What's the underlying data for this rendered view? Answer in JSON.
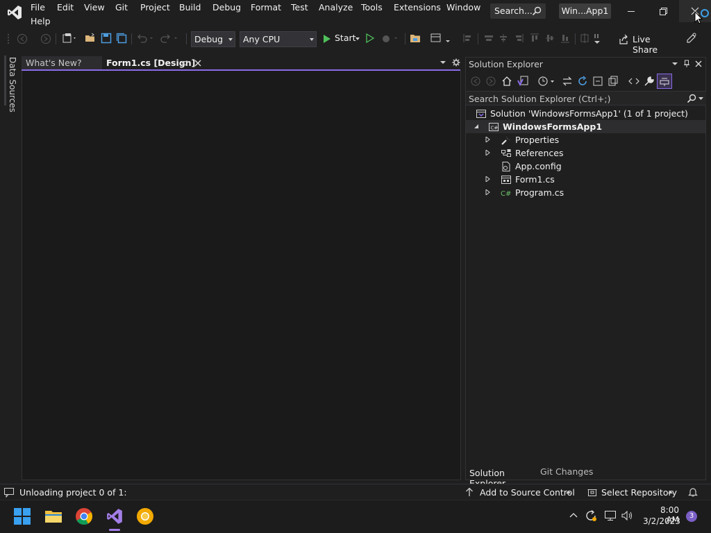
{
  "titlebar": {
    "menu": [
      "File",
      "Edit",
      "View",
      "Git",
      "Project",
      "Build",
      "Debug",
      "Format",
      "Test",
      "Analyze",
      "Tools",
      "Extensions",
      "Window",
      "Help"
    ],
    "search_label": "Search...",
    "solution_badge": "Win...App1"
  },
  "toolbar": {
    "configuration": "Debug",
    "platform": "Any CPU",
    "start_label": "Start",
    "live_share_label": "Live Share"
  },
  "left_panel": {
    "data_sources_label": "Data Sources"
  },
  "document_tabs": [
    {
      "label": "What's New?",
      "active": false
    },
    {
      "label": "Form1.cs [Design]",
      "active": true
    }
  ],
  "solution_explorer": {
    "title": "Solution Explorer",
    "search_placeholder": "Search Solution Explorer (Ctrl+;)",
    "tree": [
      {
        "label": "Solution 'WindowsFormsApp1' (1 of 1 project)",
        "icon": "solution-icon",
        "expander": "none",
        "level": 0
      },
      {
        "label": "WindowsFormsApp1",
        "icon": "csharp-project-icon",
        "expander": "expanded",
        "level": 1,
        "selected": true
      },
      {
        "label": "Properties",
        "icon": "wrench-icon",
        "expander": "collapsed",
        "level": 2
      },
      {
        "label": "References",
        "icon": "references-icon",
        "expander": "collapsed",
        "level": 2
      },
      {
        "label": "App.config",
        "icon": "config-file-icon",
        "expander": "none",
        "level": 2
      },
      {
        "label": "Form1.cs",
        "icon": "form-icon",
        "expander": "collapsed",
        "level": 2
      },
      {
        "label": "Program.cs",
        "icon": "csharp-file-icon",
        "expander": "collapsed",
        "level": 2
      }
    ],
    "bottom_tabs": [
      "Solution Explorer",
      "Git Changes"
    ]
  },
  "statusbar": {
    "message": "Unloading project 0 of 1:",
    "source_control": "Add to Source Control",
    "repository": "Select Repository"
  },
  "taskbar": {
    "time": "8:00 AM",
    "date": "3/2/2023",
    "notification_count": "3"
  },
  "colors": {
    "accent": "#8a6be8",
    "background": "#1f1f1f"
  }
}
